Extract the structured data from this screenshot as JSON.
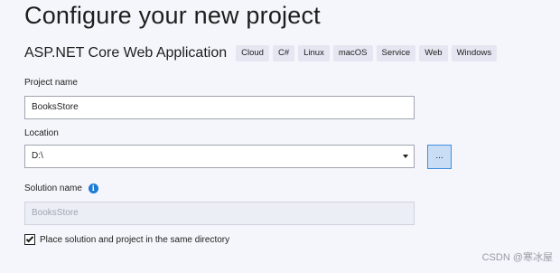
{
  "page": {
    "title": "Configure your new project"
  },
  "template": {
    "name": "ASP.NET Core Web Application",
    "tags": [
      "Cloud",
      "C#",
      "Linux",
      "macOS",
      "Service",
      "Web",
      "Windows"
    ]
  },
  "project_name": {
    "label": "Project name",
    "value": "BooksStore"
  },
  "location": {
    "label": "Location",
    "value": "D:\\",
    "browse_label": "..."
  },
  "solution_name": {
    "label": "Solution name",
    "value": "BooksStore",
    "info_glyph": "i"
  },
  "same_directory": {
    "label": "Place solution and project in the same directory",
    "checked": true
  },
  "watermark": "CSDN @寒冰屋"
}
